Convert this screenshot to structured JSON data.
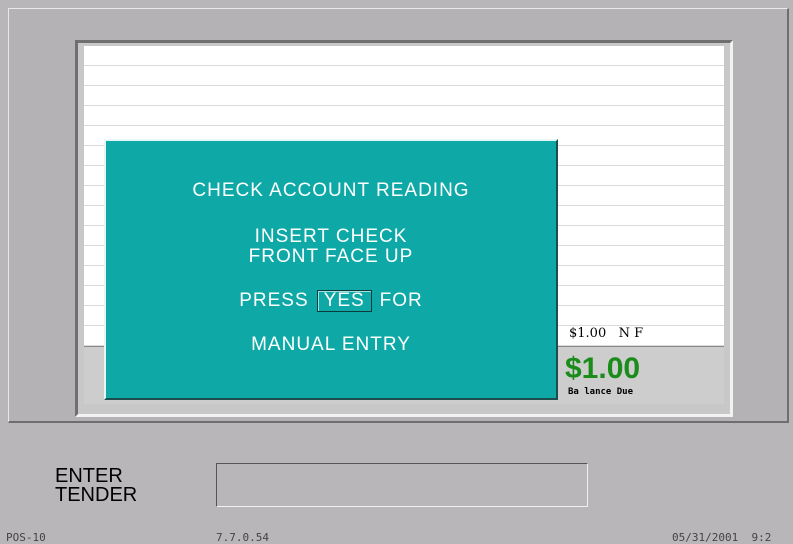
{
  "receipt": {
    "line_item": "$1.00   N F",
    "balance_amount": "$1.00",
    "balance_label": "Ba lance Due"
  },
  "dialog": {
    "line1": "CHECK ACCOUNT READING",
    "line2": "INSERT CHECK",
    "line3": "FRONT FACE UP",
    "press_text": "PRESS",
    "yes_key": "YES",
    "for_text": "FOR",
    "line5": "MANUAL ENTRY"
  },
  "tender": {
    "label_line1": "ENTER",
    "label_line2": "TENDER",
    "input_value": ""
  },
  "status": {
    "terminal": "POS-10",
    "version": "7.7.0.54",
    "datetime": "05/31/2001  9:2"
  },
  "colors": {
    "dialog_bg": "#0ea9a7",
    "balance_green": "#1a8c1a",
    "background": "#b9b6b9"
  }
}
